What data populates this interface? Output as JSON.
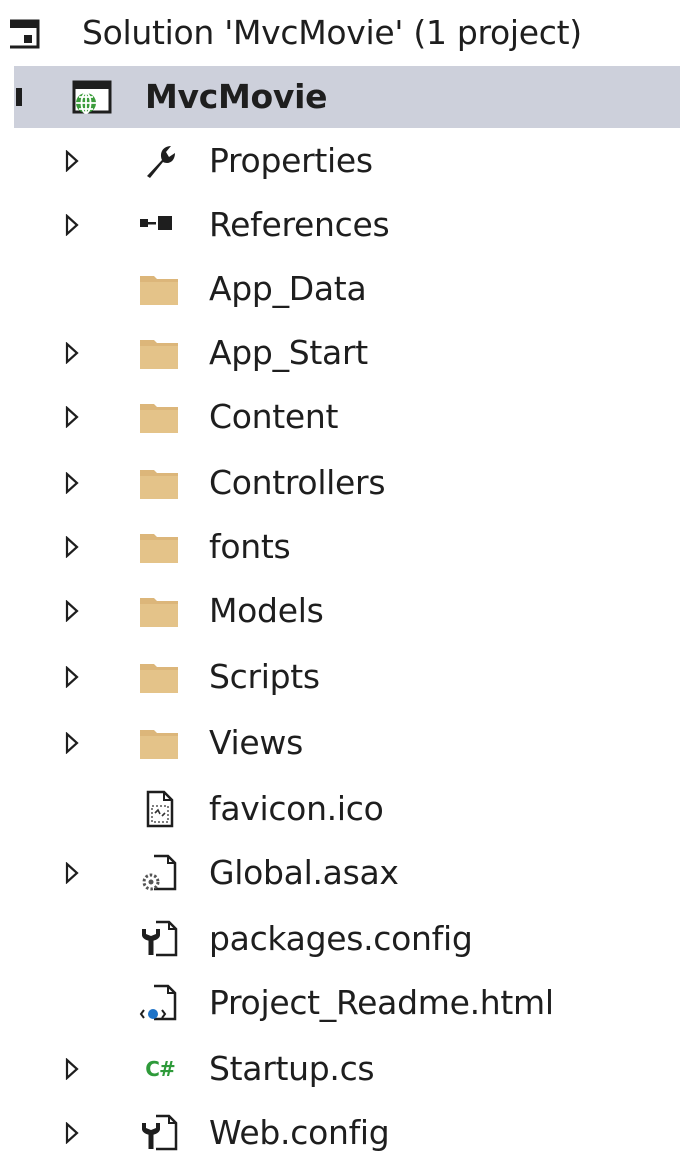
{
  "solution": {
    "label": "Solution 'MvcMovie' (1 project)"
  },
  "project": {
    "label": "MvcMovie"
  },
  "items": [
    {
      "label": "Properties",
      "icon": "wrench-icon",
      "expandable": true
    },
    {
      "label": "References",
      "icon": "references-icon",
      "expandable": true
    },
    {
      "label": "App_Data",
      "icon": "folder-icon",
      "expandable": false
    },
    {
      "label": "App_Start",
      "icon": "folder-icon",
      "expandable": true
    },
    {
      "label": "Content",
      "icon": "folder-icon",
      "expandable": true
    },
    {
      "label": "Controllers",
      "icon": "folder-icon",
      "expandable": true
    },
    {
      "label": "fonts",
      "icon": "folder-icon",
      "expandable": true
    },
    {
      "label": "Models",
      "icon": "folder-icon",
      "expandable": true
    },
    {
      "label": "Scripts",
      "icon": "folder-icon",
      "expandable": true
    },
    {
      "label": "Views",
      "icon": "folder-icon",
      "expandable": true
    },
    {
      "label": "favicon.ico",
      "icon": "image-file-icon",
      "expandable": false
    },
    {
      "label": "Global.asax",
      "icon": "gear-file-icon",
      "expandable": true
    },
    {
      "label": "packages.config",
      "icon": "config-file-icon",
      "expandable": false
    },
    {
      "label": "Project_Readme.html",
      "icon": "html-file-icon",
      "expandable": false
    },
    {
      "label": "Startup.cs",
      "icon": "csharp-icon",
      "csharp_glyph": "C#",
      "expandable": true
    },
    {
      "label": "Web.config",
      "icon": "config-file-icon",
      "expandable": true
    }
  ],
  "colors": {
    "selection": "#cdd0db",
    "folder": "#dcb67a",
    "text": "#1e1e1e",
    "csharp": "#2e9a3a"
  }
}
